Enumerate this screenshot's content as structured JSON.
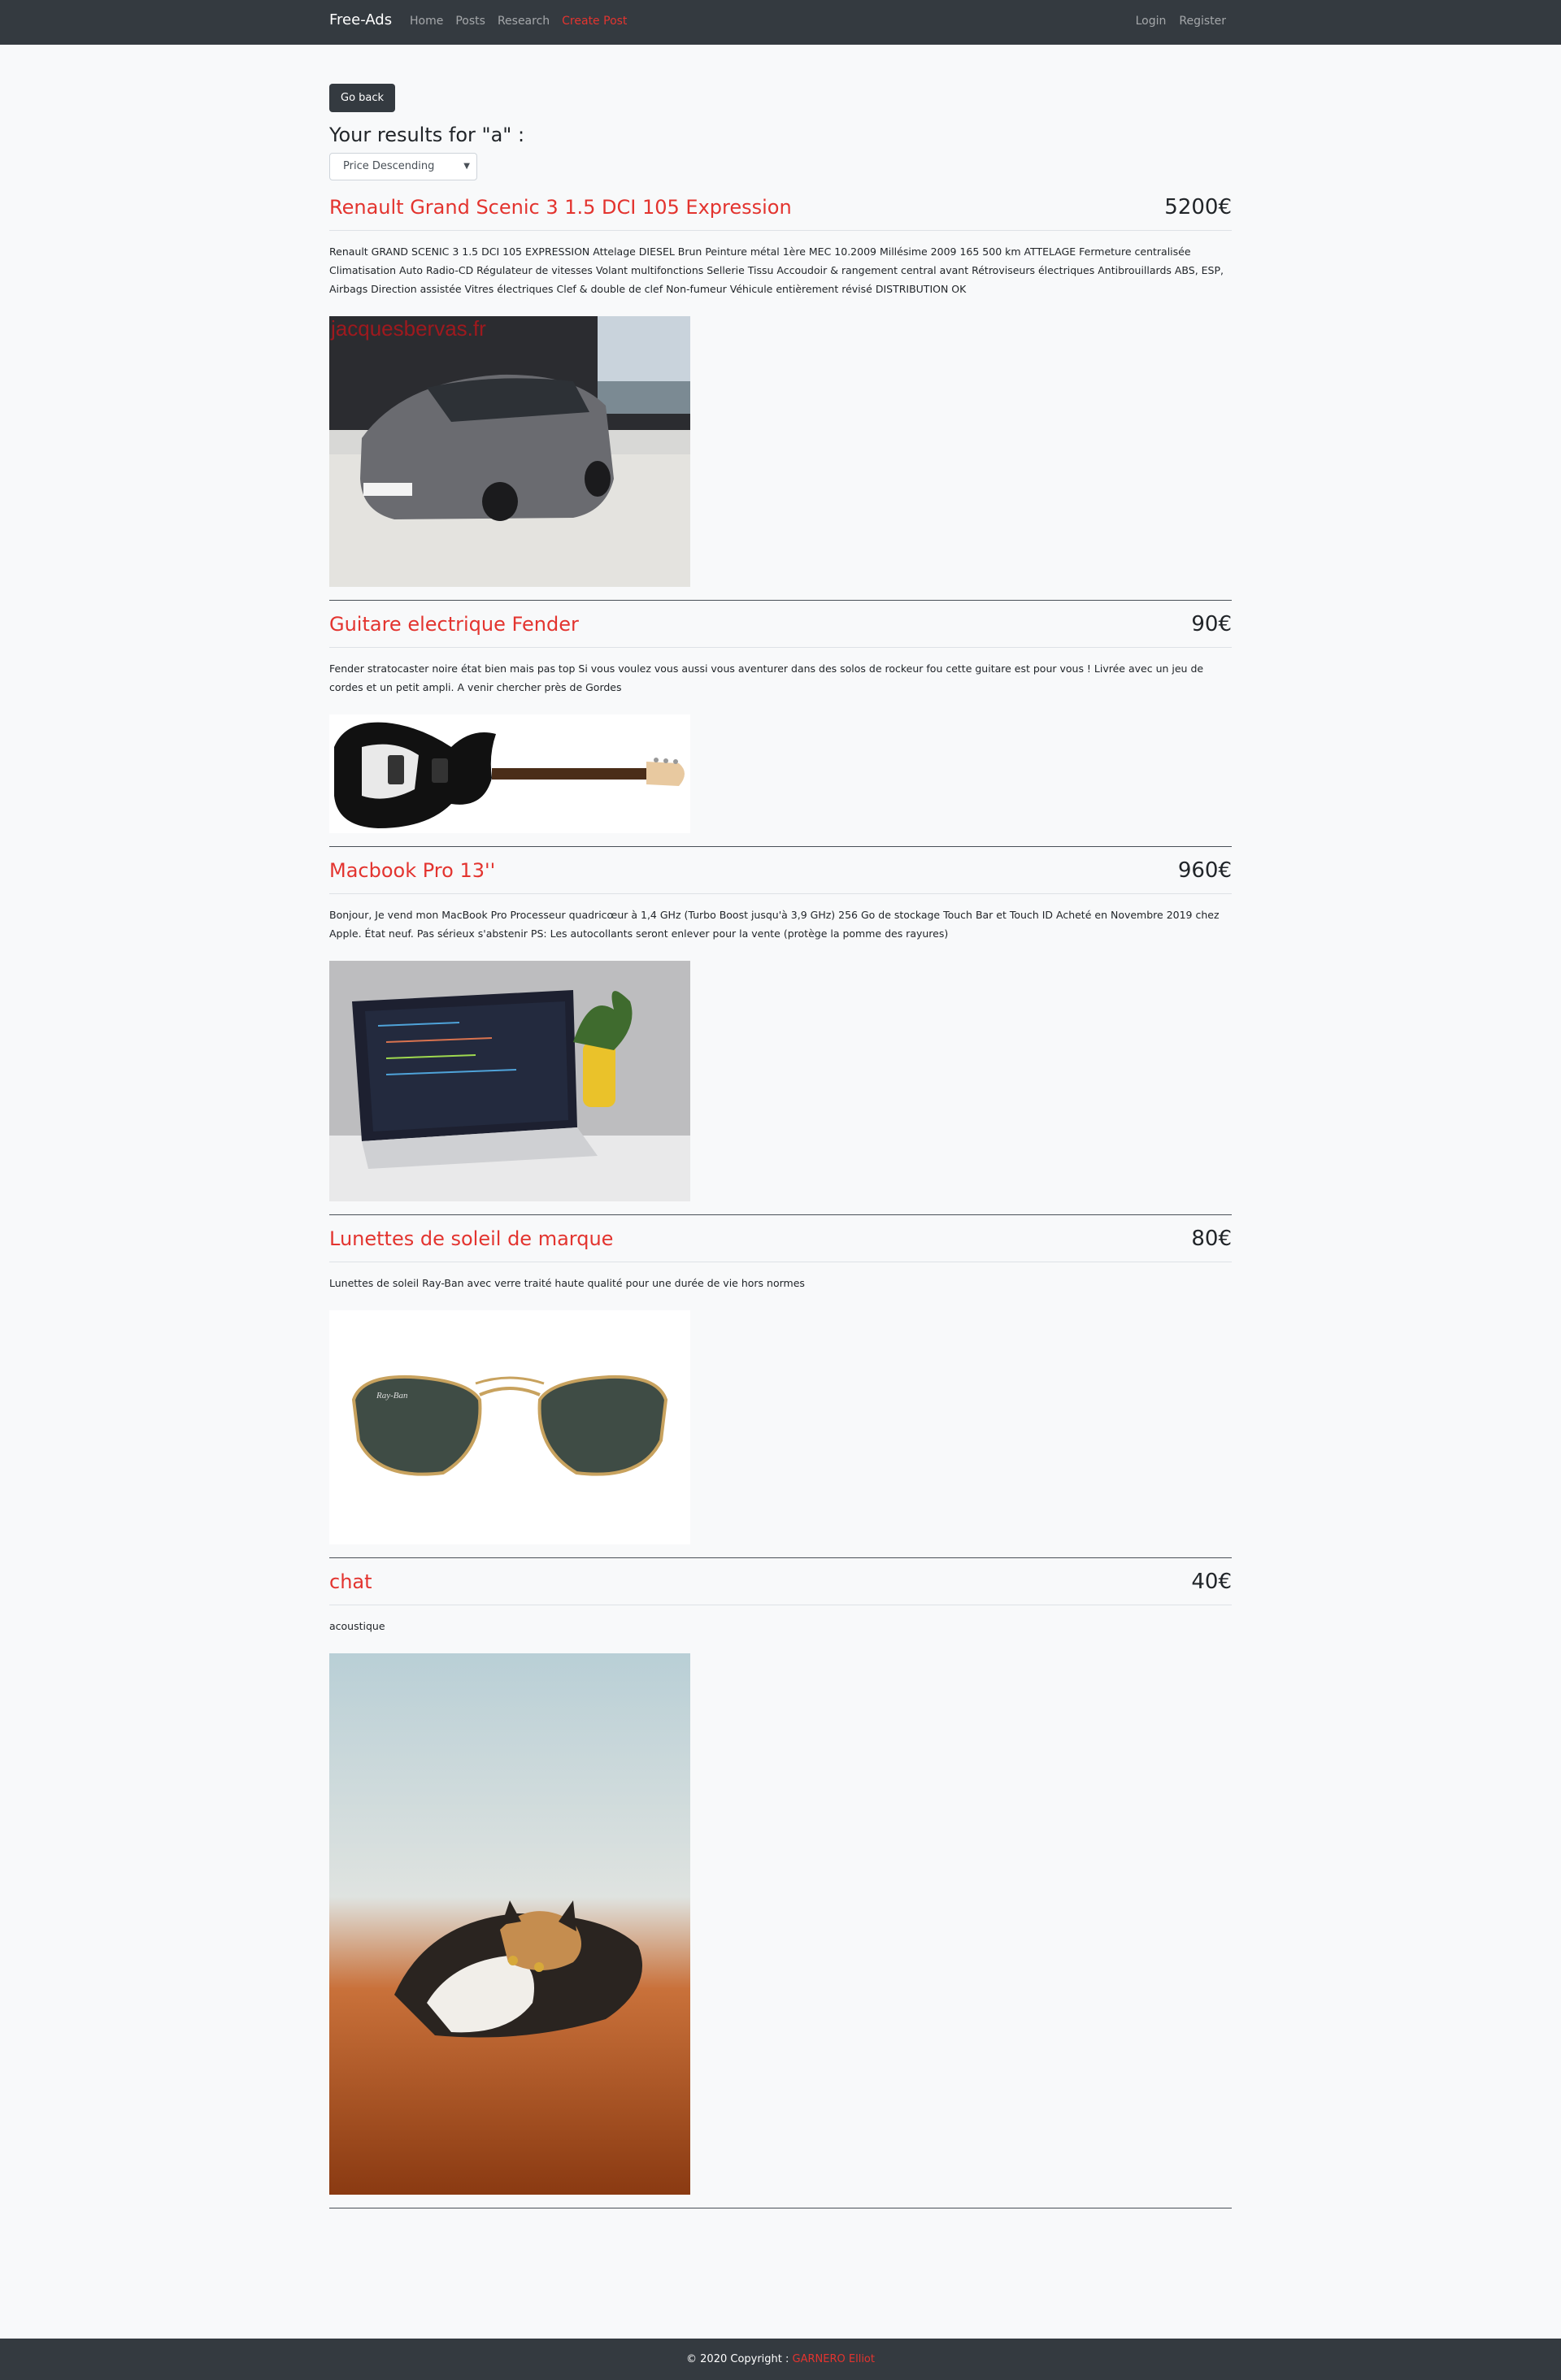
{
  "nav": {
    "brand": "Free-Ads",
    "links": [
      "Home",
      "Posts",
      "Research",
      "Create Post"
    ],
    "right_links": [
      "Login",
      "Register"
    ]
  },
  "go_back_label": "Go back",
  "results_title": "Your results for \"a\" :",
  "sort": {
    "selected": "Price Descending"
  },
  "posts": [
    {
      "title": "Renault Grand Scenic 3 1.5 DCI 105 Expression",
      "price": "5200€",
      "description": "Renault GRAND SCENIC 3 1.5 DCI 105 EXPRESSION Attelage DIESEL Brun Peinture métal 1ère MEC 10.2009 Millésime 2009 165 500 km ATTELAGE Fermeture centralisée Climatisation Auto Radio-CD Régulateur de vitesses Volant multifonctions Sellerie Tissu Accoudoir & rangement central avant Rétroviseurs électriques Antibrouillards ABS, ESP, Airbags Direction assistée Vitres électriques Clef & double de clef Non-fumeur Véhicule entièrement révisé DISTRIBUTION OK",
      "image": "car-photo",
      "image_watermark": "jacquesbervas.fr"
    },
    {
      "title": "Guitare electrique Fender",
      "price": "90€",
      "description": "Fender stratocaster noire état bien mais pas top Si vous voulez vous aussi vous aventurer dans des solos de rockeur fou cette guitare est pour vous ! Livrée avec un jeu de cordes et un petit ampli. A venir chercher près de Gordes",
      "image": "guitar-photo"
    },
    {
      "title": "Macbook Pro 13''",
      "price": "960€",
      "description": "Bonjour, Je vend mon MacBook Pro Processeur quadricœur à 1,4 GHz (Turbo Boost jusqu'à 3,9 GHz) 256 Go de stockage Touch Bar et Touch ID Acheté en Novembre 2019 chez Apple. État neuf. Pas sérieux s'abstenir PS: Les autocollants seront enlever pour la vente (protège la pomme des rayures)",
      "image": "laptop-photo"
    },
    {
      "title": "Lunettes de soleil de marque",
      "price": "80€",
      "description": "Lunettes de soleil Ray-Ban avec verre traité haute qualité pour une durée de vie hors normes",
      "image": "sunglasses-photo",
      "image_logo": "Ray-Ban"
    },
    {
      "title": "chat",
      "price": "40€",
      "description": "acoustique",
      "image": "cat-photo"
    }
  ],
  "footer": {
    "copyright": "© 2020 Copyright :",
    "author": "GARNERO Elliot"
  }
}
